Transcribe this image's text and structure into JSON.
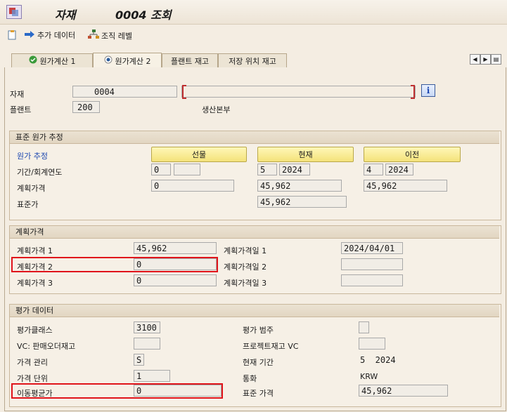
{
  "title": {
    "left": "자재",
    "right": "0004 조회"
  },
  "toolbar": {
    "add_data": "추가 데이터",
    "org_levels": "조직 레벨"
  },
  "tabs": [
    "원가계산 1",
    "원가계산 2",
    "플랜트 재고",
    "저장 위치 재고"
  ],
  "header": {
    "material_label": "자재",
    "material_value": "0004",
    "material_desc": "",
    "plant_label": "플랜트",
    "plant_value": "200",
    "plant_desc": "생산본부"
  },
  "std_cost": {
    "title": "표준 원가 추정",
    "row_label": "원가 추정",
    "buttons": [
      "선물",
      "현재",
      "이전"
    ],
    "period_label": "기간/회계연도",
    "periods": [
      [
        "0",
        ""
      ],
      [
        "5",
        "2024"
      ],
      [
        "4",
        "2024"
      ]
    ],
    "plan_price_label": "계획가격",
    "plan_prices": [
      "0",
      "45,962",
      "45,962"
    ],
    "std_price_label": "표준가",
    "std_price": "45,962"
  },
  "planned": {
    "title": "계획가격",
    "rows": [
      {
        "label": "계획가격 1",
        "value": "45,962",
        "date_label": "계획가격일 1",
        "date": "2024/04/01"
      },
      {
        "label": "계획가격 2",
        "value": "0",
        "date_label": "계획가격일 2",
        "date": ""
      },
      {
        "label": "계획가격 3",
        "value": "0",
        "date_label": "계획가격일 3",
        "date": ""
      }
    ]
  },
  "valuation": {
    "title": "평가 데이터",
    "val_class_label": "평가클래스",
    "val_class": "3100",
    "val_cat_label": "평가 범주",
    "val_cat": "",
    "vc_label": "VC: 판매오더재고",
    "vc": "",
    "proj_label": "프로젝트재고 VC",
    "proj": "",
    "price_ctrl_label": "가격 관리",
    "price_ctrl": "S",
    "cur_period_label": "현재 기간",
    "cur_period": "5  2024",
    "price_unit_label": "가격 단위",
    "price_unit": "1",
    "currency_label": "통화",
    "currency": "KRW",
    "mavg_label": "이동평균가",
    "mavg": "0",
    "std_price_label": "표준 가격",
    "std_price": "45,962"
  }
}
